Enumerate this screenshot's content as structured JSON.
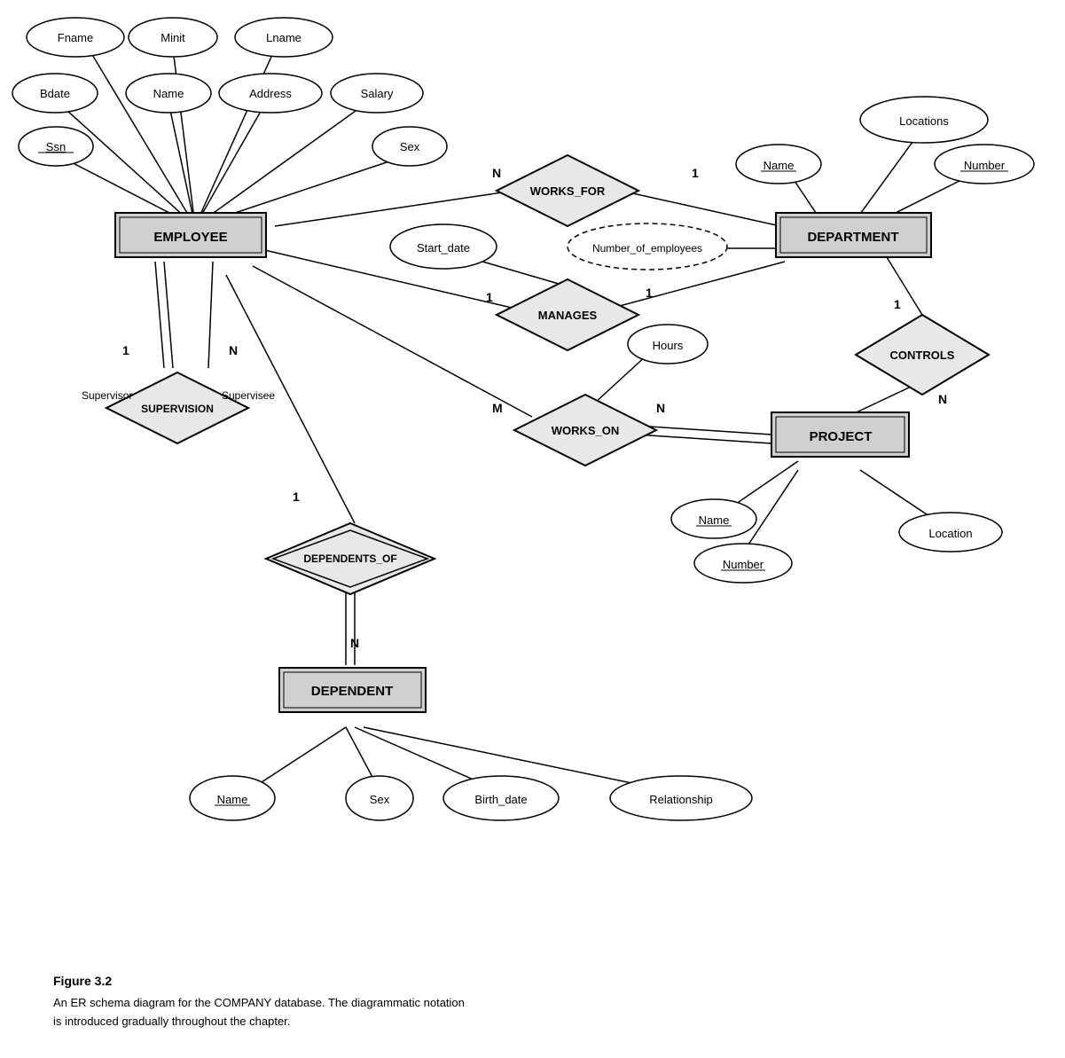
{
  "caption": {
    "title": "Figure 3.2",
    "line1": "An ER schema diagram for the COMPANY database. The diagrammatic notation",
    "line2": "is introduced gradually throughout the chapter."
  },
  "entities": {
    "employee": "EMPLOYEE",
    "department": "DEPARTMENT",
    "project": "PROJECT",
    "dependent": "DEPENDENT"
  },
  "relationships": {
    "works_for": "WORKS_FOR",
    "manages": "MANAGES",
    "works_on": "WORKS_ON",
    "controls": "CONTROLS",
    "supervision": "SUPERVISION",
    "dependents_of": "DEPENDENTS_OF"
  },
  "attributes": {
    "fname": "Fname",
    "minit": "Minit",
    "lname": "Lname",
    "bdate": "Bdate",
    "name_emp": "Name",
    "address": "Address",
    "salary": "Salary",
    "ssn": "Ssn",
    "sex_emp": "Sex",
    "start_date": "Start_date",
    "num_employees": "Number_of_employees",
    "locations": "Locations",
    "dept_name": "Name",
    "dept_number": "Number",
    "hours": "Hours",
    "proj_name": "Name",
    "proj_number": "Number",
    "proj_location": "Location",
    "dep_name": "Name",
    "dep_sex": "Sex",
    "dep_birthdate": "Birth_date",
    "dep_relationship": "Relationship"
  },
  "cardinalities": {
    "n": "N",
    "one": "1",
    "m": "M"
  }
}
